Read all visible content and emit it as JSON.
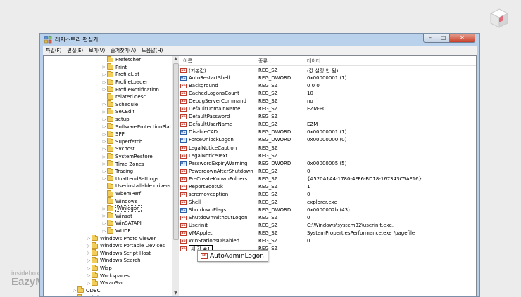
{
  "window": {
    "title": "레지스트리 편집기",
    "controls": {
      "minimize": "–",
      "maximize": "□",
      "close": "✕"
    }
  },
  "menu": [
    "파일(F)",
    "편집(E)",
    "보기(V)",
    "즐겨찾기(A)",
    "도움말(H)"
  ],
  "tree": [
    {
      "label": "Prefetcher",
      "level": 2,
      "expander": false
    },
    {
      "label": "Print",
      "level": 2,
      "expander": true
    },
    {
      "label": "ProfileList",
      "level": 2,
      "expander": true
    },
    {
      "label": "ProfileLoader",
      "level": 2,
      "expander": true
    },
    {
      "label": "ProfileNotification",
      "level": 2,
      "expander": true
    },
    {
      "label": "related.desc",
      "level": 2,
      "expander": false
    },
    {
      "label": "Schedule",
      "level": 2,
      "expander": true
    },
    {
      "label": "SeCEdit",
      "level": 2,
      "expander": true
    },
    {
      "label": "setup",
      "level": 2,
      "expander": true
    },
    {
      "label": "SoftwareProtectionPlatform",
      "level": 2,
      "expander": true
    },
    {
      "label": "SPP",
      "level": 2,
      "expander": true
    },
    {
      "label": "Superfetch",
      "level": 2,
      "expander": true
    },
    {
      "label": "Svchost",
      "level": 2,
      "expander": true
    },
    {
      "label": "SystemRestore",
      "level": 2,
      "expander": true
    },
    {
      "label": "Time Zones",
      "level": 2,
      "expander": true
    },
    {
      "label": "Tracing",
      "level": 2,
      "expander": true
    },
    {
      "label": "UnattendSettings",
      "level": 2,
      "expander": true
    },
    {
      "label": "Userinstallable.drivers",
      "level": 2,
      "expander": false
    },
    {
      "label": "WbemPerf",
      "level": 2,
      "expander": false
    },
    {
      "label": "Windows",
      "level": 2,
      "expander": false
    },
    {
      "label": "Winlogon",
      "level": 2,
      "expander": true,
      "selected": true
    },
    {
      "label": "Winsat",
      "level": 2,
      "expander": true
    },
    {
      "label": "WinSATAPI",
      "level": 2,
      "expander": true
    },
    {
      "label": "WUDF",
      "level": 2,
      "expander": true
    },
    {
      "label": "Windows Photo Viewer",
      "level": 1,
      "expander": true
    },
    {
      "label": "Windows Portable Devices",
      "level": 1,
      "expander": true
    },
    {
      "label": "Windows Script Host",
      "level": 1,
      "expander": true
    },
    {
      "label": "Windows Search",
      "level": 1,
      "expander": true
    },
    {
      "label": "Wisp",
      "level": 1,
      "expander": true
    },
    {
      "label": "Workspaces",
      "level": 1,
      "expander": true
    },
    {
      "label": "WwanSvc",
      "level": 1,
      "expander": true
    },
    {
      "label": "ODBC",
      "level": 0,
      "expander": true
    },
    {
      "label": "Policies",
      "level": 0,
      "expander": true
    }
  ],
  "columns": {
    "name": "이름",
    "type": "종류",
    "data": "데이터"
  },
  "values": [
    {
      "name": "(기본값)",
      "type": "REG_SZ",
      "data": "(값 설정 안 됨)",
      "icon": "sz"
    },
    {
      "name": "AutoRestartShell",
      "type": "REG_DWORD",
      "data": "0x00000001 (1)",
      "icon": "dw"
    },
    {
      "name": "Background",
      "type": "REG_SZ",
      "data": "0 0 0",
      "icon": "sz"
    },
    {
      "name": "CachedLogonsCount",
      "type": "REG_SZ",
      "data": "10",
      "icon": "sz"
    },
    {
      "name": "DebugServerCommand",
      "type": "REG_SZ",
      "data": "no",
      "icon": "sz"
    },
    {
      "name": "DefaultDomainName",
      "type": "REG_SZ",
      "data": "EZM-PC",
      "icon": "sz"
    },
    {
      "name": "DefaultPassword",
      "type": "REG_SZ",
      "data": "",
      "icon": "sz"
    },
    {
      "name": "DefaultUserName",
      "type": "REG_SZ",
      "data": "EZM",
      "icon": "sz"
    },
    {
      "name": "DisableCAD",
      "type": "REG_DWORD",
      "data": "0x00000001 (1)",
      "icon": "dw"
    },
    {
      "name": "ForceUnlockLogon",
      "type": "REG_DWORD",
      "data": "0x00000000 (0)",
      "icon": "dw"
    },
    {
      "name": "LegalNoticeCaption",
      "type": "REG_SZ",
      "data": "",
      "icon": "sz"
    },
    {
      "name": "LegalNoticeText",
      "type": "REG_SZ",
      "data": "",
      "icon": "sz"
    },
    {
      "name": "PasswordExpiryWarning",
      "type": "REG_DWORD",
      "data": "0x00000005 (5)",
      "icon": "dw"
    },
    {
      "name": "PowerdownAfterShutdown",
      "type": "REG_SZ",
      "data": "0",
      "icon": "sz"
    },
    {
      "name": "PreCreateKnownFolders",
      "type": "REG_SZ",
      "data": "{A520A1A4-1780-4FF6-BD18-167343C5AF16}",
      "icon": "sz"
    },
    {
      "name": "ReportBootOk",
      "type": "REG_SZ",
      "data": "1",
      "icon": "sz"
    },
    {
      "name": "scremoveoption",
      "type": "REG_SZ",
      "data": "0",
      "icon": "sz"
    },
    {
      "name": "Shell",
      "type": "REG_SZ",
      "data": "explorer.exe",
      "icon": "sz"
    },
    {
      "name": "ShutdownFlags",
      "type": "REG_DWORD",
      "data": "0x0000002b (43)",
      "icon": "dw"
    },
    {
      "name": "ShutdownWithoutLogon",
      "type": "REG_SZ",
      "data": "0",
      "icon": "sz"
    },
    {
      "name": "Userinit",
      "type": "REG_SZ",
      "data": "C:\\Windows\\system32\\userinit.exe,",
      "icon": "sz"
    },
    {
      "name": "VMApplet",
      "type": "REG_SZ",
      "data": "SystemPropertiesPerformance.exe /pagefile",
      "icon": "sz"
    },
    {
      "name": "WinStationsDisabled",
      "type": "REG_SZ",
      "data": "0",
      "icon": "sz"
    },
    {
      "name": "새 값 #1",
      "type": "REG_SZ",
      "data": "",
      "icon": "sz",
      "editing": true
    }
  ],
  "tooltip": {
    "text": "AutoAdminLogon",
    "icon": "sz"
  },
  "watermark": {
    "line1": "insidebox",
    "line2": "EazyManual"
  }
}
